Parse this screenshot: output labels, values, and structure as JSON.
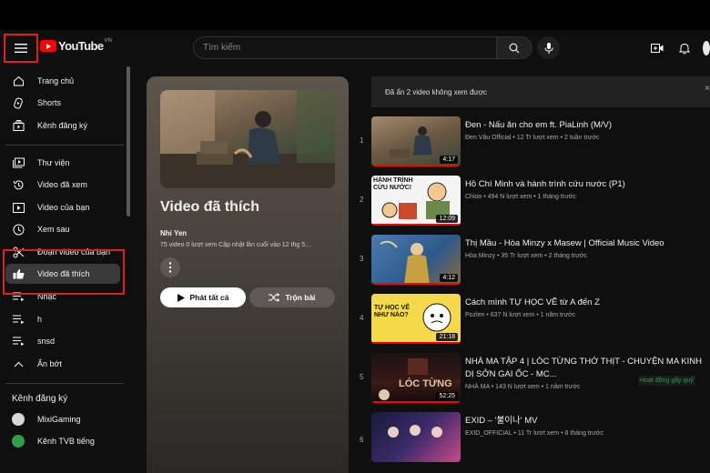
{
  "header": {
    "logo_text": "YouTube",
    "country_code": "VN",
    "search_placeholder": "Tìm kiếm"
  },
  "sidebar": {
    "items": [
      {
        "label": "Trang chủ",
        "icon": "home-icon"
      },
      {
        "label": "Shorts",
        "icon": "shorts-icon"
      },
      {
        "label": "Kênh đăng ký",
        "icon": "subscriptions-icon"
      },
      {
        "label": "Thư viện",
        "icon": "library-icon"
      },
      {
        "label": "Video đã xem",
        "icon": "history-icon"
      },
      {
        "label": "Video của bạn",
        "icon": "your-videos-icon"
      },
      {
        "label": "Xem sau",
        "icon": "clock-icon"
      },
      {
        "label": "Đoạn video của bạn",
        "icon": "scissors-icon"
      },
      {
        "label": "Video đã thích",
        "icon": "thumbs-up-icon"
      },
      {
        "label": "Nhạc",
        "icon": "playlist-icon"
      },
      {
        "label": "h",
        "icon": "playlist-icon"
      },
      {
        "label": "snsd",
        "icon": "playlist-icon"
      },
      {
        "label": "Ẩn bớt",
        "icon": "chevron-up-icon"
      }
    ],
    "subscriptions_heading": "Kênh đăng ký",
    "subscriptions": [
      {
        "label": "MixiGaming"
      },
      {
        "label": "Kênh TVB tiếng"
      }
    ]
  },
  "playlist": {
    "title": "Video đã thích",
    "owner": "Nhi Yen",
    "meta": "75 video   0 lượt xem   Cập nhật lần cuối vào 12 thg 5...",
    "play_all_label": "Phát tất cả",
    "shuffle_label": "Trộn bài"
  },
  "notice": {
    "text": "Đã ẩn 2 video không xem được"
  },
  "videos": [
    {
      "num": "1",
      "title": "Đen - Nấu ăn cho em ft. PiaLinh (M/V)",
      "meta": "Đen Vâu Official • 12 Tr lượt xem • 2 tuần trước",
      "duration": "4:17"
    },
    {
      "num": "2",
      "title": "Hồ Chí Minh và hành trình cứu nước (P1)",
      "meta": "Chioo • 494 N lượt xem • 1 tháng trước",
      "duration": "12:09",
      "thumb_text": "HÀNH TRÌNH CỨU NƯỚC!"
    },
    {
      "num": "3",
      "title": "Thị Mầu - Hòa Minzy x Masew | Official Music Video",
      "meta": "Hòa Minzy • 35 Tr lượt xem • 2 tháng trước",
      "duration": "4:12"
    },
    {
      "num": "4",
      "title": "Cách mình TỰ HỌC VẼ từ A đến Z",
      "meta": "Pozlen • 637 N lượt xem • 1 năm trước",
      "duration": "21:18",
      "thumb_text": "TỰ HỌC VẼ NHƯ NÀO?"
    },
    {
      "num": "5",
      "title": "NHÀ MA TẬP 4 | LÓC TỪNG THỚ THỊT - CHUYỆN MA KINH DỊ SỞN GAI ỐC - MC...",
      "meta": "NHÀ MA • 143 N lượt xem • 1 năm trước",
      "duration": "52:25",
      "thumb_text": "LÓC TỪNG"
    },
    {
      "num": "6",
      "title": "EXID – '불이나' MV",
      "meta": "EXID_OFFICIAL • 11 Tr lượt xem • 8 tháng trước",
      "duration": ""
    }
  ],
  "activity_badge": "Hoạt động gây quỹ",
  "colors": {
    "accent": "#ff0000",
    "highlight_box": "#e02020"
  }
}
